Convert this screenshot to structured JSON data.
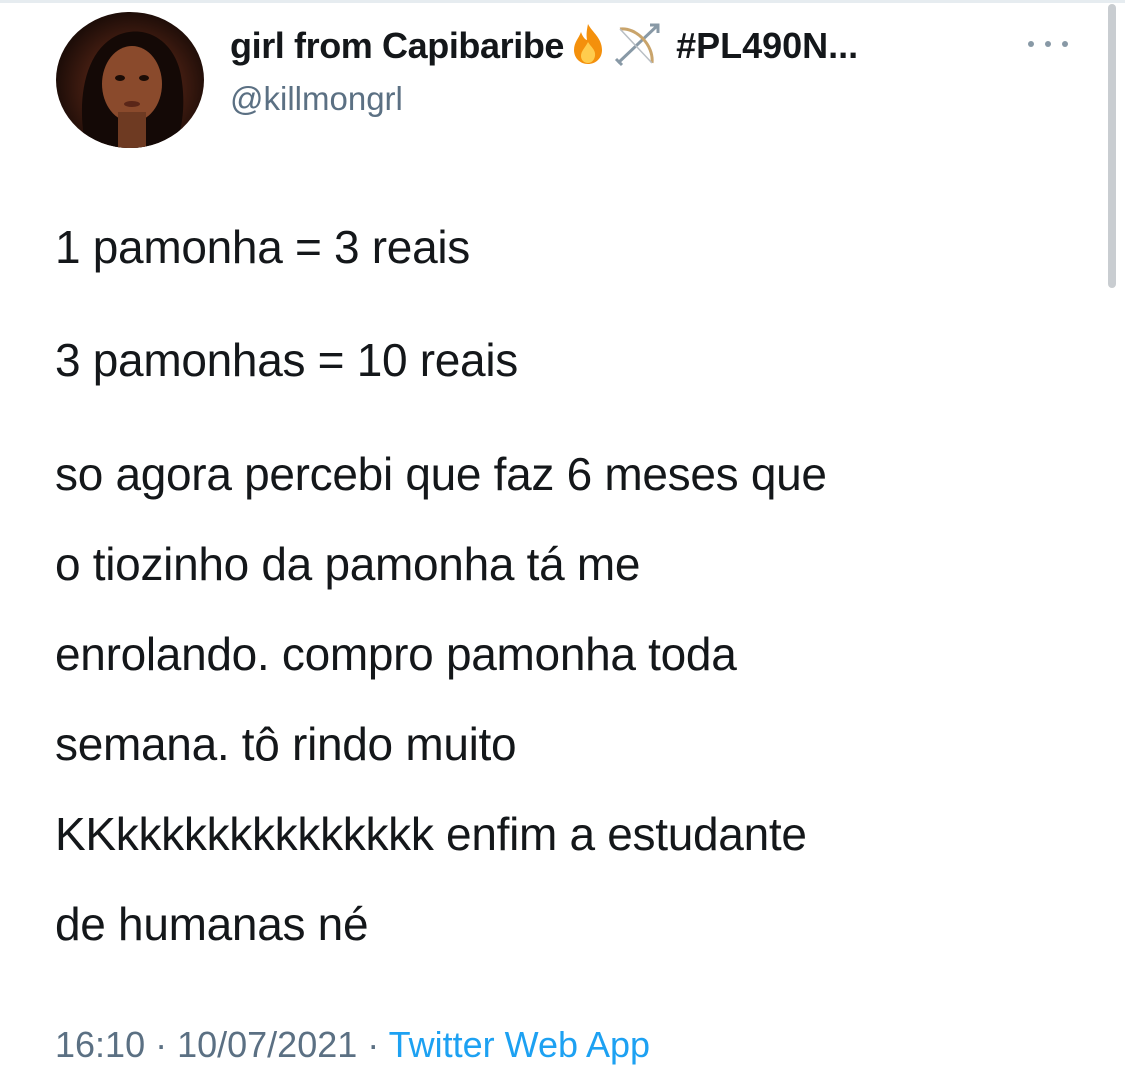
{
  "tweet": {
    "author": {
      "display_name": "girl from Capibaribe",
      "name_emojis": [
        "fire-emoji",
        "bow-and-arrow-emoji"
      ],
      "name_hashtag": "#PL490N...",
      "handle": "@killmongrl",
      "avatar": "profile-photo"
    },
    "more_icon": "more-options-icon",
    "lines": {
      "l1": "1 pamonha = 3 reais",
      "l2": "3 pamonhas = 10 reais",
      "p1": "so agora percebi que faz 6 meses que",
      "p2": "o tiozinho da pamonha tá me",
      "p3": "enrolando. compro pamonha toda",
      "p4": "semana. tô rindo muito",
      "p5": "KKkkkkkkkkkkkkkk enfim a estudante",
      "p6": "de humanas né"
    },
    "time": "16:10",
    "separator": " · ",
    "date": "10/07/2021",
    "source": "Twitter Web App"
  },
  "colors": {
    "text": "#14171a",
    "secondary": "#5b7083",
    "link": "#1da1f2"
  }
}
